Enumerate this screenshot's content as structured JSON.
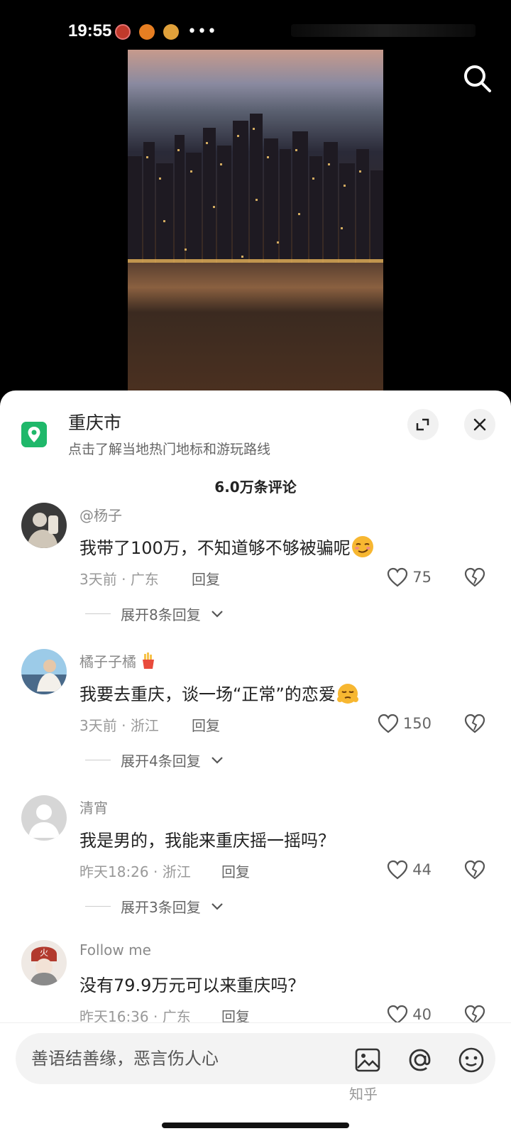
{
  "status_bar": {
    "time": "19:55",
    "dots": "•••"
  },
  "location": {
    "title": "重庆市",
    "subtitle": "点击了解当地热门地标和游玩路线"
  },
  "comments_header": "6.0万条评论",
  "comments": [
    {
      "username": "@杨子",
      "text": "我带了100万，不知道够不够被骗呢",
      "time": "3天前",
      "region": "广东",
      "reply": "回复",
      "likes": "75",
      "expand": "展开8条回复"
    },
    {
      "username": "橘子子橘",
      "text": "我要去重庆，谈一场“正常”的恋爱",
      "time": "3天前",
      "region": "浙江",
      "reply": "回复",
      "likes": "150",
      "expand": "展开4条回复"
    },
    {
      "username": "清宵",
      "text": "我是男的，我能来重庆摇一摇吗？",
      "time": "昨天18:26",
      "region": "浙江",
      "reply": "回复",
      "likes": "44",
      "expand": "展开3条回复"
    },
    {
      "username": "Follow me",
      "text": "没有79.9万元可以来重庆吗？",
      "time": "昨天16:36",
      "region": "广东",
      "reply": "回复",
      "likes": "40"
    }
  ],
  "input": {
    "placeholder": "善语结善缘，恶言伤人心"
  },
  "watermark": "知乎",
  "colors": {
    "location_green": "#1fb86a",
    "sheet_bg": "#ffffff",
    "screen_bg": "#000000"
  }
}
